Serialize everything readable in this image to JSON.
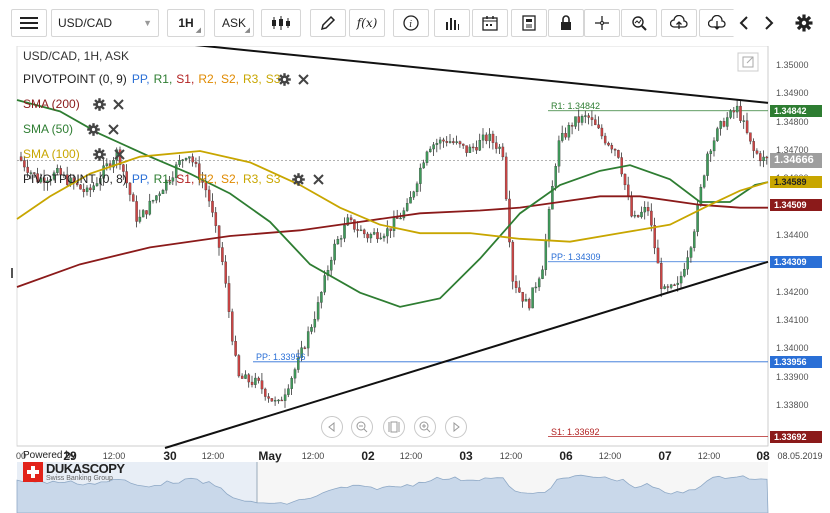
{
  "toolbar": {
    "symbol": "USD/CAD",
    "timeframe": "1H",
    "side": "ASK"
  },
  "chart": {
    "title": "USD/CAD, 1H, ASK",
    "legend": [
      {
        "label": "PIVOTPOINT (0, 9)",
        "color": "#333333",
        "levels": [
          "PP",
          "R1",
          "S1",
          "R2",
          "S2",
          "R3",
          "S3"
        ]
      },
      {
        "label": "SMA (200)",
        "color": "#8b1a1a"
      },
      {
        "label": "SMA (50)",
        "color": "#2e7d32"
      },
      {
        "label": "SMA (100)",
        "color": "#c8a600"
      },
      {
        "label": "PIVOTPOINT (0, 8)",
        "color": "#333333",
        "levels": [
          "PP",
          "R1",
          "S1",
          "R2",
          "S2",
          "R3",
          "S3"
        ]
      }
    ],
    "level_colors": {
      "PP": "#2a6fd6",
      "R1": "#2e7d32",
      "S1": "#b22222",
      "R2": "#e08a00",
      "S2": "#e08a00",
      "R3": "#c8a600",
      "S3": "#c8a600"
    },
    "price_axis": [
      "1.35000",
      "1.34900",
      "1.34800",
      "1.34700",
      "1.34600",
      "1.34500",
      "1.34400",
      "1.34300",
      "1.34200",
      "1.34100",
      "1.34000",
      "1.33900",
      "1.33800"
    ],
    "price_tags": [
      {
        "value": "1.34842",
        "color": "#2e7d32"
      },
      {
        "value": "1.34666",
        "color": "#9e9e9e"
      },
      {
        "value": "1.34589",
        "color": "#c8a600"
      },
      {
        "value": "1.34509",
        "color": "#8b1a1a"
      },
      {
        "value": "1.34309",
        "color": "#2a6fd6"
      },
      {
        "value": "1.33956",
        "color": "#2a6fd6"
      },
      {
        "value": "1.33692",
        "color": "#8b1a1a"
      }
    ],
    "level_labels": {
      "r1": "R1: 1.34842",
      "pp_new": "PP: 1.34309",
      "pp_old": "PP: 1.33956",
      "s1": "S1: 1.33692"
    },
    "x_axis": [
      {
        "text": "00",
        "big": false
      },
      {
        "text": "29",
        "big": true
      },
      {
        "text": "12:00",
        "big": false
      },
      {
        "text": "30",
        "big": true
      },
      {
        "text": "12:00",
        "big": false
      },
      {
        "text": "May",
        "big": true
      },
      {
        "text": "12:00",
        "big": false
      },
      {
        "text": "02",
        "big": true
      },
      {
        "text": "12:00",
        "big": false
      },
      {
        "text": "03",
        "big": true
      },
      {
        "text": "12:00",
        "big": false
      },
      {
        "text": "06",
        "big": true
      },
      {
        "text": "12:00",
        "big": false
      },
      {
        "text": "07",
        "big": true
      },
      {
        "text": "12:00",
        "big": false
      },
      {
        "text": "08",
        "big": true
      },
      {
        "text": "08.05.2019",
        "big": false
      }
    ],
    "brand": {
      "powered_by": "Powered by",
      "name": "DUKASCOPY",
      "sub": "Swiss Banking Group"
    }
  }
}
